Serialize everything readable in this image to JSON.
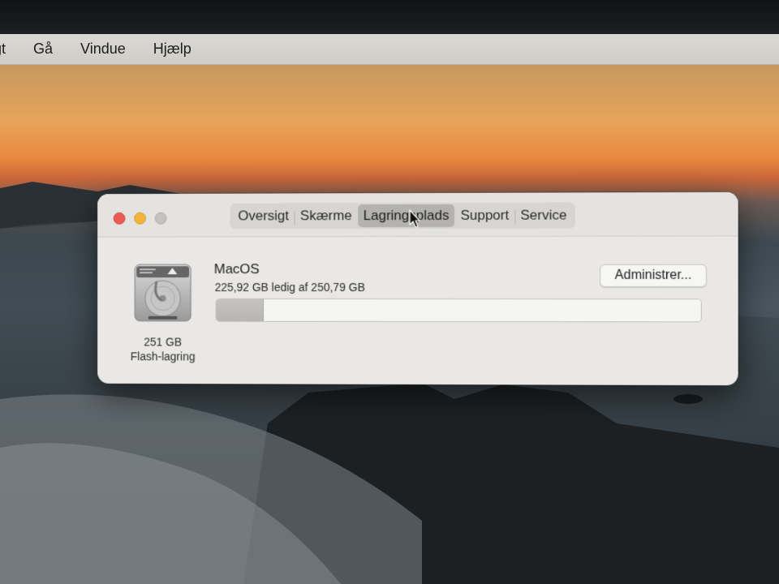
{
  "menubar": {
    "items": [
      {
        "label": "gt"
      },
      {
        "label": "Gå"
      },
      {
        "label": "Vindue"
      },
      {
        "label": "Hjælp"
      }
    ]
  },
  "window": {
    "tabs": [
      {
        "label": "Oversigt",
        "active": false
      },
      {
        "label": "Skærme",
        "active": false
      },
      {
        "label": "Lagringsplads",
        "active": true
      },
      {
        "label": "Support",
        "active": false
      },
      {
        "label": "Service",
        "active": false
      }
    ],
    "disk": {
      "icon": "hard-drive-icon",
      "size": "251 GB",
      "kind": "Flash-lagring"
    },
    "volume": {
      "name": "MacOS",
      "free_text": "225,92 GB ledig af 250,79 GB",
      "used_fraction": 0.099
    },
    "manage_button": "Administrer..."
  },
  "colors": {
    "close": "#ec5b52",
    "minimize": "#f1b53a",
    "zoom": "#c3c2c0"
  }
}
